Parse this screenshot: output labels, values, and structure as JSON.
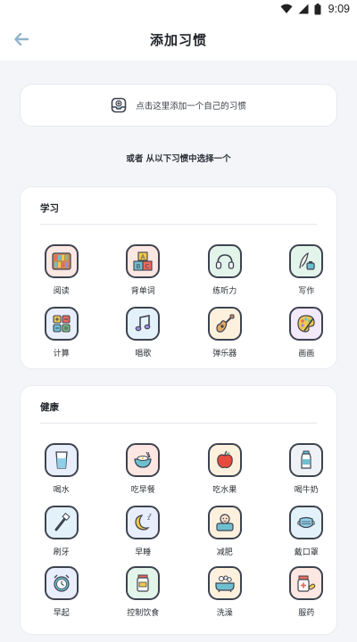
{
  "status": {
    "time": "9:09"
  },
  "header": {
    "title": "添加习惯"
  },
  "add_card": {
    "label": "点击这里添加一个自己的习惯"
  },
  "or_text": "或者 从以下习惯中选择一个",
  "sections": [
    {
      "title": "学习",
      "items": [
        {
          "label": "阅读",
          "icon": "bookshelf-icon"
        },
        {
          "label": "背单词",
          "icon": "abc-blocks-icon"
        },
        {
          "label": "练听力",
          "icon": "headphones-icon"
        },
        {
          "label": "写作",
          "icon": "quill-ink-icon"
        },
        {
          "label": "计算",
          "icon": "calculator-icon"
        },
        {
          "label": "唱歌",
          "icon": "music-note-icon"
        },
        {
          "label": "弹乐器",
          "icon": "guitar-icon"
        },
        {
          "label": "画画",
          "icon": "paint-palette-icon"
        }
      ]
    },
    {
      "title": "健康",
      "items": [
        {
          "label": "喝水",
          "icon": "water-glass-icon"
        },
        {
          "label": "吃早餐",
          "icon": "breakfast-bowl-icon"
        },
        {
          "label": "吃水果",
          "icon": "apple-icon"
        },
        {
          "label": "喝牛奶",
          "icon": "milk-bottle-icon"
        },
        {
          "label": "刷牙",
          "icon": "toothbrush-icon"
        },
        {
          "label": "早睡",
          "icon": "moon-sleep-icon"
        },
        {
          "label": "减肥",
          "icon": "scale-icon"
        },
        {
          "label": "戴口罩",
          "icon": "face-mask-icon"
        },
        {
          "label": "早起",
          "icon": "alarm-clock-icon"
        },
        {
          "label": "控制饮食",
          "icon": "food-jar-icon"
        },
        {
          "label": "洗澡",
          "icon": "bathtub-icon"
        },
        {
          "label": "服药",
          "icon": "medicine-icon"
        }
      ]
    }
  ],
  "colors": {
    "background": "#f3f5f9",
    "card": "#ffffff",
    "back_arrow": "#8fb3c9",
    "icon_outline": "#3e4350"
  }
}
